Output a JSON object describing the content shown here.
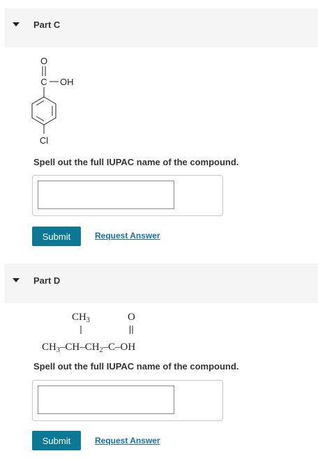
{
  "parts": [
    {
      "title": "Part C",
      "prompt": "Spell out the full IUPAC name of the compound.",
      "answer_value": "",
      "submit_label": "Submit",
      "request_label": "Request Answer",
      "structure": {
        "oxygen": "O",
        "carboxyl_carbon": "C",
        "hydroxyl": "OH",
        "substituent": "Cl"
      }
    },
    {
      "title": "Part D",
      "prompt": "Spell out the full IUPAC name of the compound.",
      "answer_value": "",
      "submit_label": "Submit",
      "request_label": "Request Answer",
      "structure": {
        "top_left": "CH",
        "top_left_sub": "3",
        "top_right": "O",
        "ch3": "CH",
        "ch3_sub": "3",
        "ch": "CH",
        "ch2": "CH",
        "ch2_sub": "2",
        "c": "C",
        "oh": "OH"
      }
    }
  ],
  "colors": {
    "accent": "#0c7896",
    "link": "#1b6fa8",
    "header_bg": "#f5f5f5"
  }
}
